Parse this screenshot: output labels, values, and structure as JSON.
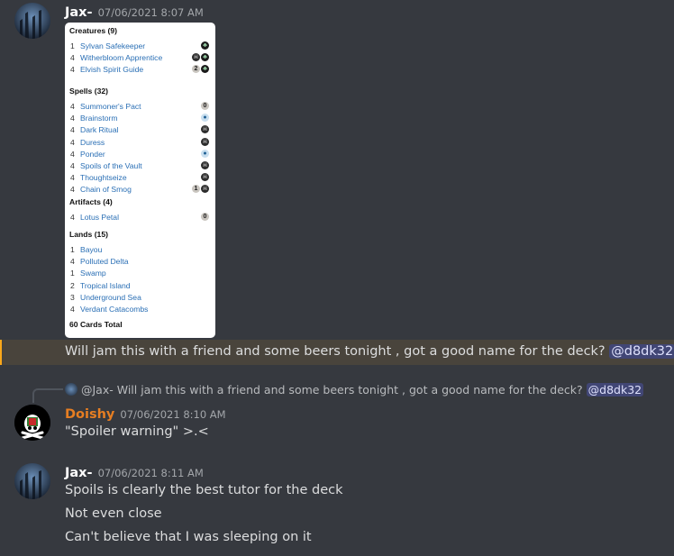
{
  "colors": {
    "background": "#36393f",
    "jax_name": "#ffffff",
    "doishy_name": "#e67e22",
    "link": "#2a6fb5",
    "mention_bg": "#414675",
    "highlight_bar": "#faa81a"
  },
  "message1": {
    "username": "Jax-",
    "timestamp": "07/06/2021 8:07 AM",
    "deck": {
      "sections": [
        {
          "title": "Creatures (9)",
          "cards": [
            {
              "qty": "1",
              "name": "Sylvan Safekeeper",
              "cost": [
                "G"
              ]
            },
            {
              "qty": "4",
              "name": "Witherbloom Apprentice",
              "cost": [
                "B",
                "G"
              ]
            },
            {
              "qty": "4",
              "name": "Elvish Spirit Guide",
              "cost": [
                "2",
                "G"
              ]
            }
          ]
        },
        {
          "title": "Spells (32)",
          "cards": [
            {
              "qty": "4",
              "name": "Summoner's Pact",
              "cost": [
                "0"
              ]
            },
            {
              "qty": "4",
              "name": "Brainstorm",
              "cost": [
                "U"
              ]
            },
            {
              "qty": "4",
              "name": "Dark Ritual",
              "cost": [
                "B"
              ]
            },
            {
              "qty": "4",
              "name": "Duress",
              "cost": [
                "B"
              ]
            },
            {
              "qty": "4",
              "name": "Ponder",
              "cost": [
                "U"
              ]
            },
            {
              "qty": "4",
              "name": "Spoils of the Vault",
              "cost": [
                "B"
              ]
            },
            {
              "qty": "4",
              "name": "Thoughtseize",
              "cost": [
                "B"
              ]
            },
            {
              "qty": "4",
              "name": "Chain of Smog",
              "cost": [
                "1",
                "B"
              ]
            }
          ]
        },
        {
          "title": "Artifacts (4)",
          "cards": [
            {
              "qty": "4",
              "name": "Lotus Petal",
              "cost": [
                "0"
              ]
            }
          ]
        },
        {
          "title": "Lands (15)",
          "cards": [
            {
              "qty": "1",
              "name": "Bayou",
              "cost": []
            },
            {
              "qty": "4",
              "name": "Polluted Delta",
              "cost": []
            },
            {
              "qty": "1",
              "name": "Swamp",
              "cost": []
            },
            {
              "qty": "2",
              "name": "Tropical Island",
              "cost": []
            },
            {
              "qty": "3",
              "name": "Underground Sea",
              "cost": []
            },
            {
              "qty": "4",
              "name": "Verdant Catacombs",
              "cost": []
            }
          ]
        }
      ],
      "total": "60 Cards Total"
    },
    "text": "Will jam this with a friend and some beers tonight , got a good name for the deck?",
    "mention": "@d8dk32"
  },
  "message2": {
    "reply_author": "@Jax-",
    "reply_text": "Will jam this with a friend and some beers tonight , got a good name for the deck?",
    "reply_mention": "@d8dk32",
    "username": "Doishy",
    "timestamp": "07/06/2021 8:10 AM",
    "text": "\"Spoiler warning\" >.<"
  },
  "message3": {
    "username": "Jax-",
    "timestamp": "07/06/2021 8:11 AM",
    "lines": [
      "Spoils is clearly the best tutor for the deck",
      "Not even close",
      "Can't believe that I was sleeping on it"
    ]
  }
}
